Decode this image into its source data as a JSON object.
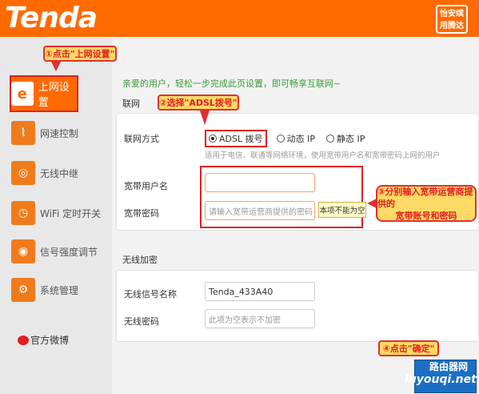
{
  "header": {
    "logo": "Tenda",
    "badge": "怡安缤\n用腾达",
    "badge_side": ""
  },
  "sidebar": {
    "items": [
      {
        "label": "上网设置",
        "icon": "e"
      },
      {
        "label": "网速控制",
        "icon": "⌇"
      },
      {
        "label": "无线中继",
        "icon": "◎"
      },
      {
        "label": "WiFi 定时开关",
        "icon": "◷"
      },
      {
        "label": "信号强度调节",
        "icon": "◉"
      },
      {
        "label": "系统管理",
        "icon": "⚙"
      }
    ],
    "weibo": "官方微博"
  },
  "callouts": {
    "step1": "①点击\"上网设置\"",
    "step2": "②选择\"ADSL拨号\"",
    "step3_line1": "③分别输入宽带运营商提供的",
    "step3_line2": "宽带账号和密码",
    "step4": "④点击\"确定\""
  },
  "main": {
    "intro": "亲爱的用户，轻松一步完成此页设置，即可畅享互联网~",
    "section_internet": "联网",
    "connect_label": "联网方式",
    "radio_options": [
      "ADSL 拨号",
      "动态 IP",
      "静态 IP"
    ],
    "selected_option": "ADSL 拨号",
    "hint": "适用于电信、联通等网络环境，使用宽带用户名和宽带密码上网的用户",
    "username_label": "宽带用户名",
    "username_value": "",
    "password_label": "宽带密码",
    "password_placeholder": "请输入宽带运营商提供的密码",
    "tooltip": "本项不能为空",
    "section_wireless": "无线加密",
    "ssid_label": "无线信号名称",
    "ssid_value": "Tenda_433A40",
    "wifi_pwd_label": "无线密码",
    "wifi_pwd_placeholder": "此项为空表示不加密"
  },
  "watermark": {
    "top": "路由器网",
    "bottom": "luyouqi.net"
  },
  "colors": {
    "brand": "#ff6a00",
    "annotation_red": "#e02020",
    "intro_green": "#3a9a3a"
  }
}
